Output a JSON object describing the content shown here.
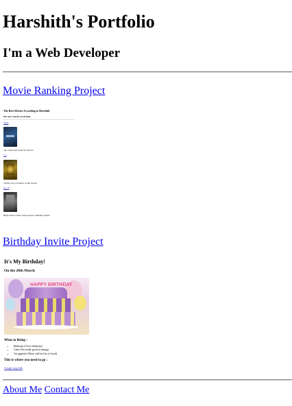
{
  "header": {
    "title": "Harshith's Portfolio",
    "subtitle": "I'm a Web Developer"
  },
  "projects": [
    {
      "label": "Movie Ranking Project",
      "preview": {
        "title": "The Best Movies According to Harshith",
        "subtitle": "My top 3 movies of all time.",
        "items": [
          {
            "link": "Tenet",
            "description": "one of my best in the SCI-FI era"
          },
          {
            "link": "1-5",
            "description": "Totally was a Creative writer movie."
          },
          {
            "link": "K.G.F",
            "description": "High action scenes, mass appeal, stunning visuals."
          }
        ]
      }
    },
    {
      "label": "Birthday Invite Project",
      "preview": {
        "title": "It's My Birthday!",
        "date": "On the 20th March",
        "image_text": "HAPPY BIRTHDAY",
        "bring_heading": "What to Bring :",
        "bring_items": [
          "Balloons (I love balloons)",
          "Cake (I'm really good at eating)",
          "An appetite (There will be lots of food)"
        ],
        "where_heading": "This is where you need to go :",
        "map_link": "Google map link"
      }
    }
  ],
  "footer": {
    "about": "About Me",
    "contact": "Contact Me"
  }
}
